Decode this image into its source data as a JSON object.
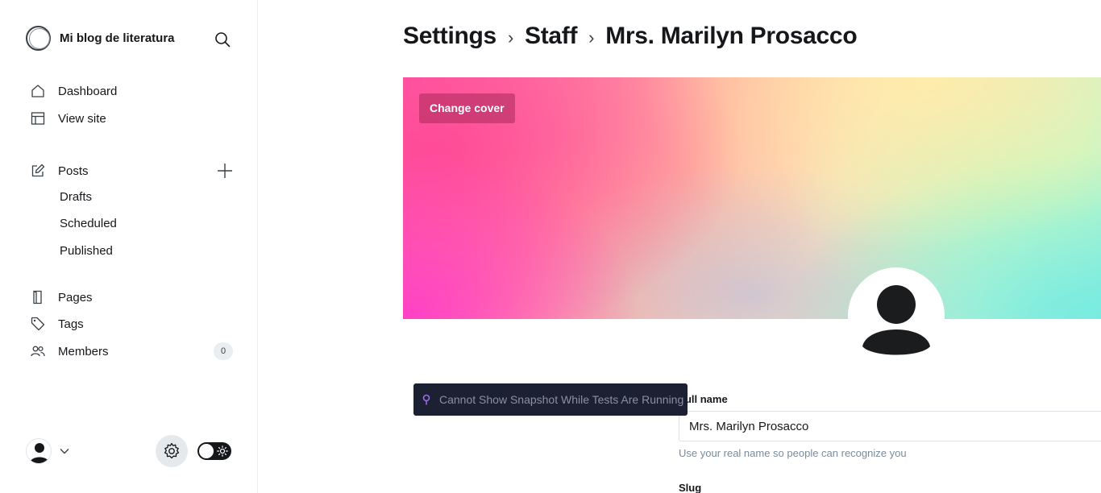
{
  "sidebar": {
    "site_title": "Mi blog de literatura",
    "nav": {
      "dashboard": "Dashboard",
      "view_site": "View site",
      "posts": "Posts",
      "drafts": "Drafts",
      "scheduled": "Scheduled",
      "published": "Published",
      "pages": "Pages",
      "tags": "Tags",
      "members": "Members",
      "members_count": "0"
    },
    "icons": [
      "search-icon",
      "home-icon",
      "layout-icon",
      "pencil-square-icon",
      "plus-icon",
      "page-icon",
      "tag-icon",
      "members-icon",
      "user-avatar-icon",
      "chevron-down-icon",
      "gear-icon",
      "sun-icon"
    ]
  },
  "header": {
    "crumbs": [
      "Settings",
      "Staff",
      "Mrs. Marilyn Prosacco"
    ],
    "separator": "›"
  },
  "cover": {
    "change_cover_label": "Change cover"
  },
  "form": {
    "full_name_label": "Full name",
    "full_name_value": "Mrs. Marilyn Prosacco",
    "full_name_hint": "Use your real name so people can recognize you",
    "slug_label": "Slug"
  },
  "tooltip": {
    "text": "Cannot Show Snapshot While Tests Are Running",
    "icon": "pin-icon",
    "color": "#a06ae8"
  }
}
